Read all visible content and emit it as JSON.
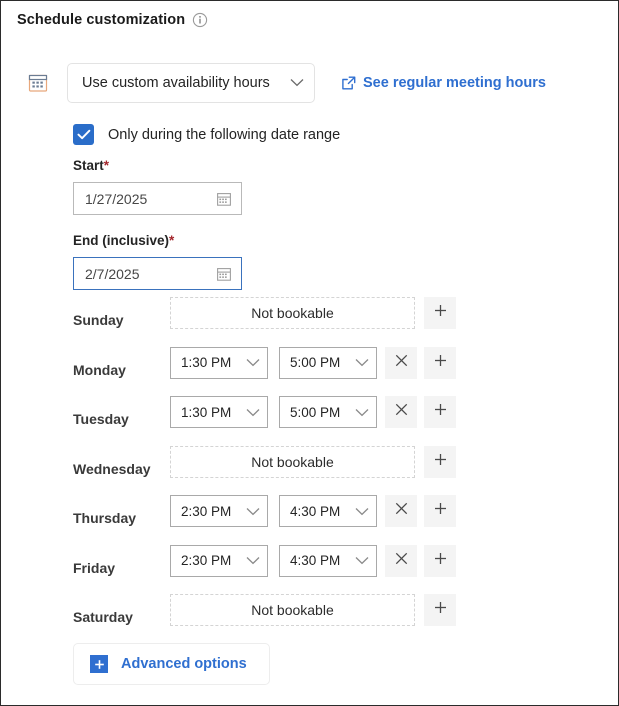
{
  "header": {
    "title": "Schedule customization",
    "info_icon": "info-circle-icon"
  },
  "mode": {
    "icon": "calendar-icon",
    "selected": "Use custom availability hours",
    "chevron": "chevron-down-icon",
    "link_label": "See regular meeting hours",
    "link_icon": "external-link-icon"
  },
  "date_range": {
    "checkbox_checked": true,
    "checkbox_label": "Only during the following date range",
    "start_label": "Start",
    "start_required": "*",
    "start_value": "1/27/2025",
    "start_icon": "calendar-picker-icon",
    "end_label": "End (inclusive)",
    "end_required": "*",
    "end_value": "2/7/2025",
    "end_icon": "calendar-picker-icon"
  },
  "schedule": {
    "not_bookable_text": "Not bookable",
    "add_icon": "plus-icon",
    "remove_icon": "close-icon",
    "days": [
      {
        "name": "Sunday",
        "bookable": false,
        "start": "",
        "end": ""
      },
      {
        "name": "Monday",
        "bookable": true,
        "start": "1:30 PM",
        "end": "5:00 PM"
      },
      {
        "name": "Tuesday",
        "bookable": true,
        "start": "1:30 PM",
        "end": "5:00 PM"
      },
      {
        "name": "Wednesday",
        "bookable": false,
        "start": "",
        "end": ""
      },
      {
        "name": "Thursday",
        "bookable": true,
        "start": "2:30 PM",
        "end": "4:30 PM"
      },
      {
        "name": "Friday",
        "bookable": true,
        "start": "2:30 PM",
        "end": "4:30 PM"
      },
      {
        "name": "Saturday",
        "bookable": false,
        "start": "",
        "end": ""
      }
    ]
  },
  "advanced": {
    "label": "Advanced options",
    "icon": "plus-square-icon"
  },
  "colors": {
    "accent_blue": "#2f6fd0",
    "checkbox_blue": "#2a6dc9",
    "focus_border": "#3a72bd",
    "required_red": "#a4262c",
    "button_bg": "#f4f4f4"
  }
}
